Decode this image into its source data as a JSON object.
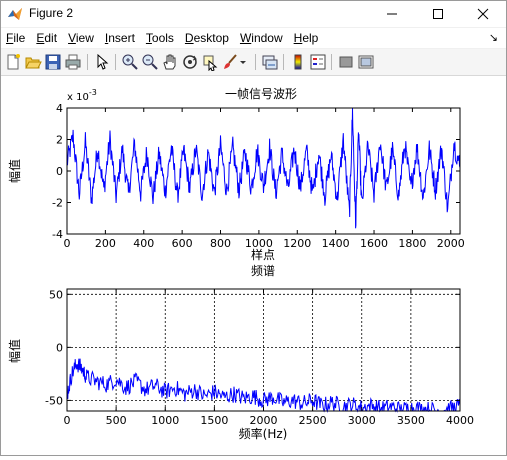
{
  "window": {
    "title": "Figure 2"
  },
  "menu": [
    {
      "pre": "",
      "u": "F",
      "post": "ile"
    },
    {
      "pre": "",
      "u": "E",
      "post": "dit"
    },
    {
      "pre": "",
      "u": "V",
      "post": "iew"
    },
    {
      "pre": "",
      "u": "I",
      "post": "nsert"
    },
    {
      "pre": "",
      "u": "T",
      "post": "ools"
    },
    {
      "pre": "",
      "u": "D",
      "post": "esktop"
    },
    {
      "pre": "",
      "u": "W",
      "post": "indow"
    },
    {
      "pre": "",
      "u": "H",
      "post": "elp"
    }
  ],
  "toolbar_icons": [
    "new-figure-icon",
    "open-file-icon",
    "save-icon",
    "print-icon",
    "edit-plot-arrow-icon",
    "zoom-in-icon",
    "zoom-out-icon",
    "pan-hand-icon",
    "rotate-3d-icon",
    "data-cursor-icon",
    "brush-icon",
    "brush-dropdown-icon",
    "link-plot-icon",
    "colorbar-icon",
    "legend-icon",
    "hide-plot-tools-icon",
    "show-plot-tools-icon"
  ],
  "colors": {
    "line": "#0000ff",
    "axes": "#000000",
    "accent_icon": "#f2a100"
  },
  "chart_data": [
    {
      "type": "line",
      "title": "一帧信号波形",
      "xlabel": "样点",
      "ylabel": "幅值",
      "exponent_label": "x 10",
      "exponent_power": "-3",
      "xlim": [
        0,
        2048
      ],
      "ylim": [
        -4,
        4
      ],
      "xticks": [
        "0",
        "200",
        "400",
        "600",
        "800",
        "1000",
        "1200",
        "1400",
        "1600",
        "1800",
        "2000"
      ],
      "yticks": [
        "-4",
        "-2",
        "0",
        "2",
        "4"
      ],
      "grid": false,
      "series": [
        {
          "x": [
            0,
            32,
            64,
            96,
            128,
            160,
            192,
            224,
            256,
            288,
            320,
            352,
            384,
            416,
            448,
            480,
            512,
            544,
            576,
            608,
            640,
            672,
            704,
            736,
            768,
            800,
            832,
            864,
            896,
            928,
            960,
            992,
            1024,
            1056,
            1088,
            1120,
            1152,
            1184,
            1216,
            1248,
            1280,
            1312,
            1344,
            1376,
            1408,
            1440,
            1472,
            1488,
            1504,
            1520,
            1536,
            1568,
            1600,
            1632,
            1664,
            1696,
            1728,
            1760,
            1792,
            1824,
            1856,
            1888,
            1920,
            1952,
            1984,
            2016,
            2048
          ],
          "values": [
            0.5,
            2.2,
            -1.5,
            1.8,
            -1.8,
            1.5,
            -1.2,
            2.0,
            -1.6,
            1.4,
            -1.5,
            1.7,
            -1.4,
            1.2,
            -1.7,
            1.1,
            -1.3,
            1.5,
            -1.6,
            1.3,
            -1.1,
            1.4,
            -1.5,
            1.2,
            -1.4,
            1.6,
            -1.3,
            1.5,
            -1.2,
            1.2,
            -1.1,
            1.3,
            -1.0,
            1.5,
            -1.4,
            1.1,
            -1.2,
            1.4,
            -1.1,
            1.3,
            -1.5,
            1.2,
            -1.6,
            1.0,
            -1.8,
            2.0,
            -2.8,
            3.8,
            -3.4,
            2.5,
            -2.2,
            1.6,
            -1.5,
            1.9,
            -1.2,
            1.3,
            -1.6,
            1.7,
            -1.1,
            1.5,
            -1.7,
            1.4,
            -1.2,
            1.5,
            -2.5,
            1.8,
            0.2
          ]
        }
      ]
    },
    {
      "type": "line",
      "title": "频谱",
      "xlabel": "频率(Hz)",
      "ylabel": "幅值",
      "xlim": [
        0,
        4000
      ],
      "ylim": [
        -60,
        55
      ],
      "xticks": [
        "0",
        "500",
        "1000",
        "1500",
        "2000",
        "2500",
        "3000",
        "3500",
        "4000"
      ],
      "yticks": [
        "-50",
        "0",
        "50"
      ],
      "grid": true,
      "series": [
        {
          "x": [
            0,
            50,
            100,
            150,
            200,
            300,
            400,
            500,
            600,
            700,
            800,
            900,
            1000,
            1100,
            1200,
            1300,
            1400,
            1500,
            1600,
            1700,
            1800,
            1900,
            2000,
            2100,
            2200,
            2300,
            2400,
            2500,
            2600,
            2700,
            2800,
            2900,
            3000,
            3100,
            3200,
            3300,
            3400,
            3500,
            3600,
            3700,
            3800,
            3900,
            4000
          ],
          "values": [
            -45,
            -25,
            -15,
            -20,
            -28,
            -32,
            -35,
            -30,
            -38,
            -32,
            -40,
            -36,
            -42,
            -38,
            -44,
            -40,
            -46,
            -42,
            -47,
            -44,
            -48,
            -46,
            -50,
            -47,
            -52,
            -50,
            -53,
            -50,
            -55,
            -52,
            -56,
            -54,
            -57,
            -55,
            -58,
            -56,
            -59,
            -57,
            -58,
            -59,
            -60,
            -58,
            -55
          ]
        }
      ]
    }
  ]
}
